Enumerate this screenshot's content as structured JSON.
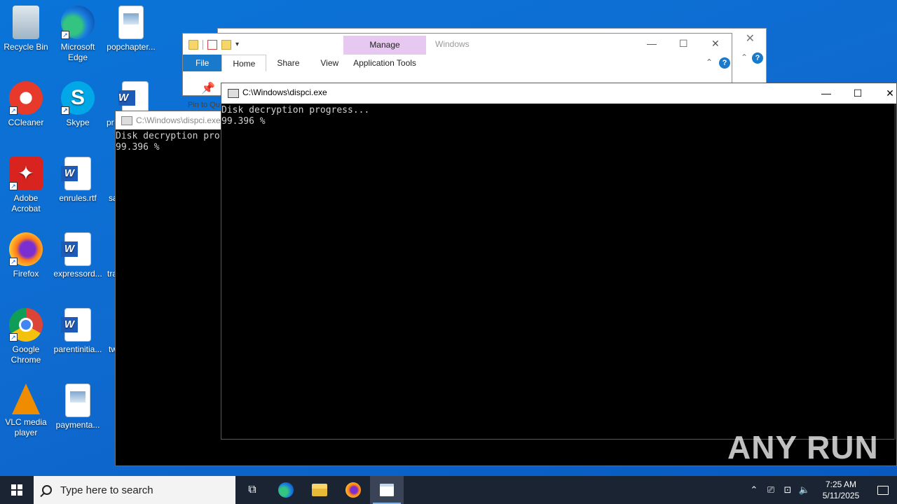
{
  "desktop": {
    "icons_col1": [
      {
        "label": "Recycle Bin",
        "icon": "recycle-bin-icon"
      },
      {
        "label": "CCleaner",
        "icon": "ccleaner-icon"
      },
      {
        "label": "Adobe Acrobat",
        "icon": "acrobat-icon"
      },
      {
        "label": "Firefox",
        "icon": "firefox-icon"
      },
      {
        "label": "Google Chrome",
        "icon": "chrome-icon"
      },
      {
        "label": "VLC media player",
        "icon": "vlc-icon"
      }
    ],
    "icons_col2": [
      {
        "label": "Microsoft Edge",
        "icon": "edge-icon"
      },
      {
        "label": "Skype",
        "icon": "skype-icon"
      },
      {
        "label": "enrules.rtf",
        "icon": "word-doc-icon"
      },
      {
        "label": "expressord...",
        "icon": "word-doc-icon"
      },
      {
        "label": "parentinitia...",
        "icon": "word-doc-icon"
      },
      {
        "label": "paymenta...",
        "icon": "image-file-icon"
      }
    ],
    "icons_col3": [
      {
        "label": "popchapter...",
        "icon": "image-file-icon"
      },
      {
        "label": "pr",
        "icon": "word-doc-icon"
      },
      {
        "label": "sa",
        "icon": ""
      },
      {
        "label": "tra",
        "icon": ""
      },
      {
        "label": "tw",
        "icon": ""
      }
    ]
  },
  "explorer": {
    "title": "Windows",
    "manage_tab": "Manage",
    "app_tools_tab": "Application Tools",
    "tabs": [
      "File",
      "Home",
      "Share",
      "View"
    ],
    "pin_label": "Pin to Qu"
  },
  "console_back": {
    "title": "C:\\Windows\\dispci.exe",
    "lines": "Disk decryption pro\n99.396 %"
  },
  "console_front": {
    "title": "C:\\Windows\\dispci.exe",
    "lines": "Disk decryption progress...\n99.396 %",
    "progress_percent": 99.396
  },
  "watermark": "ANY RUN",
  "taskbar": {
    "search_placeholder": "Type here to search",
    "time": "7:25 AM",
    "date": "5/11/2025"
  },
  "colors": {
    "desktop_bg": "#0a74d8",
    "taskbar_bg": "#1b2433",
    "ribbon_file": "#1979ca",
    "manage_tab": "#e6c8f0"
  }
}
